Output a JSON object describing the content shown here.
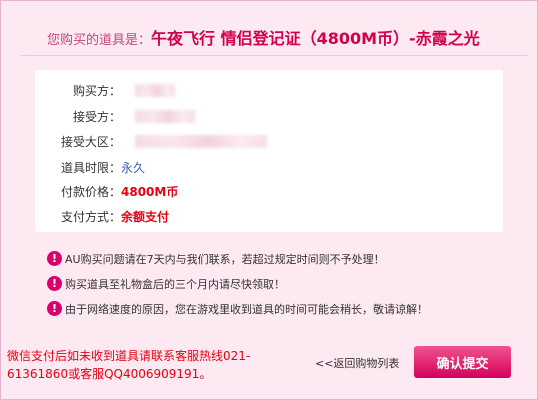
{
  "header": {
    "prefix": "您购买的道具是：",
    "item_name": "午夜飞行 情侣登记证（4800M币）-赤霞之光"
  },
  "details": [
    {
      "label": "购买方：",
      "value": "",
      "redacted": true
    },
    {
      "label": "接受方：",
      "value": "",
      "redacted": true
    },
    {
      "label": "接受大区：",
      "value": "",
      "redacted": true
    },
    {
      "label": "道具时限：",
      "value": "永久",
      "redacted": false
    },
    {
      "label": "付款价格：",
      "value": "4800M币",
      "redacted": false
    },
    {
      "label": "支付方式：",
      "value": "余额支付",
      "redacted": false
    }
  ],
  "notices": [
    "AU购买问题请在7天内与我们联系，若超过规定时间则不予处理！",
    "购买道具至礼物盒后的三个月内请尽快领取！",
    "由于网络速度的原因，您在游戏里收到道具的时间可能会稍长，敬请谅解！"
  ],
  "footer": {
    "support_text": "微信支付后如未收到道具请联系客服热线021-61361860或客服QQ4006909191。",
    "back_link": "<<返回购物列表",
    "confirm_button": "确认提交"
  },
  "icons": {
    "notice_icon": "exclamation-circle-icon"
  },
  "colors": {
    "accent": "#d3004f",
    "background": "#fde9f1",
    "button": "#e0206e",
    "price": "#e60012",
    "link_blue": "#3b5fb0"
  }
}
